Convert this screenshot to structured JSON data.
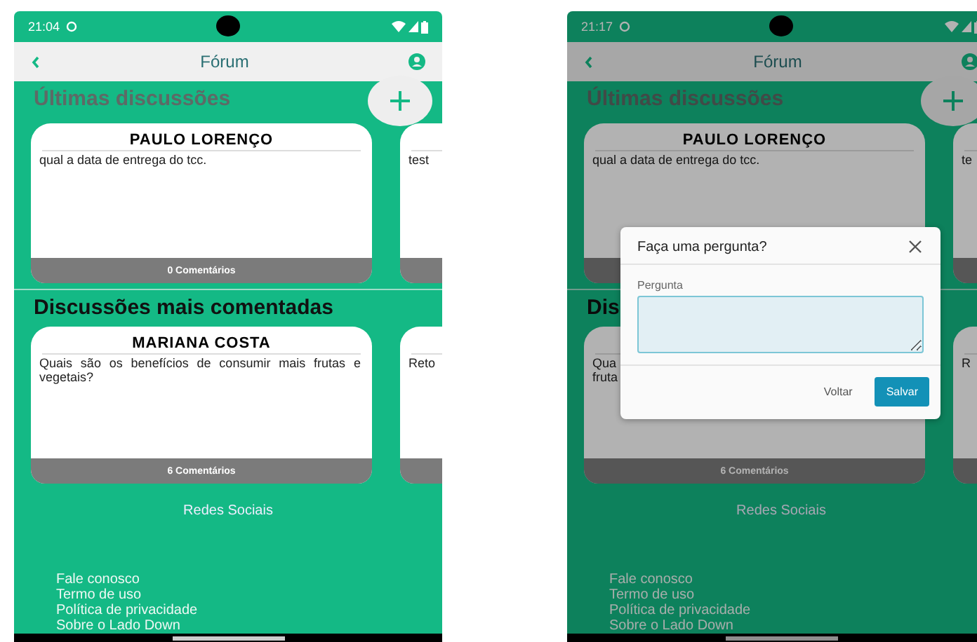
{
  "screens": [
    {
      "status_time": "21:04",
      "title": "Fórum",
      "sections": [
        {
          "title": "Últimas discussões",
          "add_button": true,
          "cards": [
            {
              "author": "PAULO LORENÇO",
              "text": "qual a data de entrega do tcc.",
              "comments": "0 Comentários"
            },
            {
              "text": "test"
            }
          ]
        },
        {
          "title": "Discussões mais comentadas",
          "cards": [
            {
              "author": "MARIANA COSTA",
              "text": "Quais são os benefícios de consumir mais frutas e vegetais?",
              "comments": "6 Comentários"
            },
            {
              "text": "Reto"
            }
          ]
        }
      ],
      "social_title": "Redes Sociais",
      "links": [
        "Fale conosco",
        "Termo de uso",
        "Política de privacidade",
        "Sobre o Lado Down"
      ]
    },
    {
      "status_time": "21:17",
      "title": "Fórum",
      "sections": [
        {
          "title": "Últimas discussões",
          "add_button": true,
          "cards": [
            {
              "author": "PAULO LORENÇO",
              "text": "qual a data de entrega do tcc."
            },
            {
              "text": "te"
            }
          ]
        },
        {
          "title": "Dis",
          "cards": [
            {
              "text": "Qua\nfruta",
              "comments": "6 Comentários"
            },
            {
              "text": "R"
            }
          ]
        }
      ],
      "social_title": "Redes Sociais",
      "links": [
        "Fale conosco",
        "Termo de uso",
        "Política de privacidade",
        "Sobre o Lado Down"
      ],
      "dialog": {
        "title": "Faça uma pergunta?",
        "field_label": "Pergunta",
        "buttons": [
          {
            "label": "Voltar",
            "kind": "text"
          },
          {
            "label": "Salvar",
            "kind": "primary"
          }
        ]
      }
    }
  ]
}
